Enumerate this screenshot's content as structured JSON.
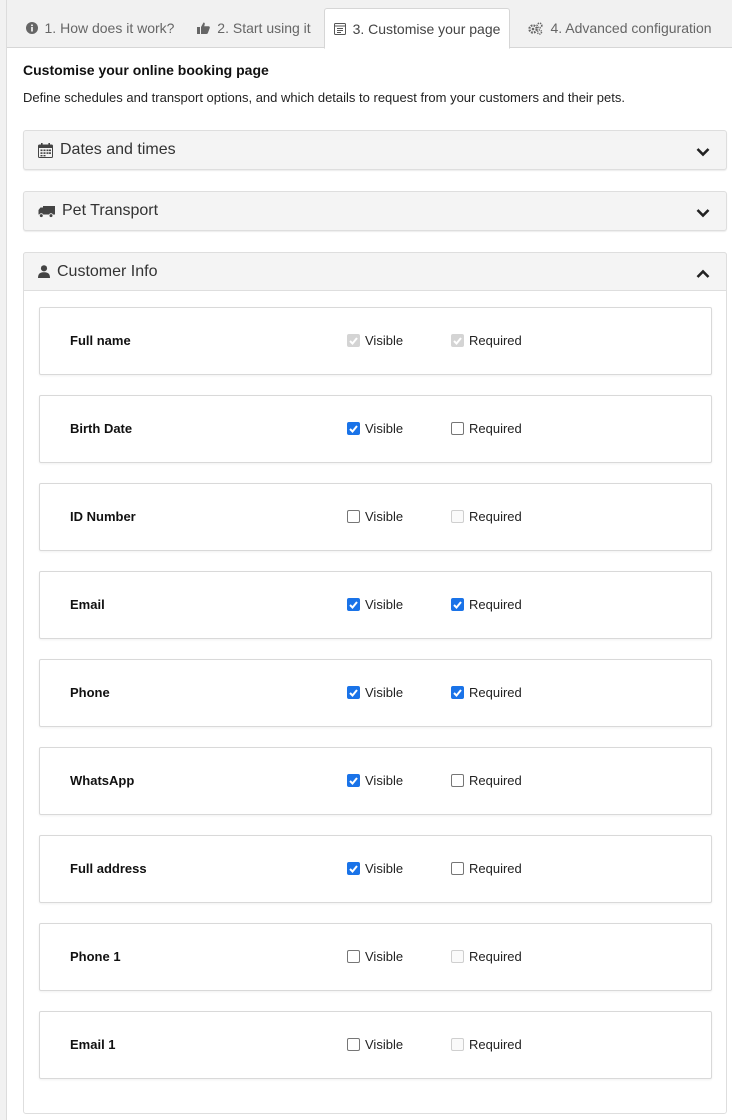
{
  "tabs": [
    {
      "label": "1. How does it work?",
      "icon": "info-circle-icon",
      "active": false
    },
    {
      "label": "2. Start using it",
      "icon": "thumbs-up-icon",
      "active": false
    },
    {
      "label": "3. Customise your page",
      "icon": "page-icon",
      "active": true
    },
    {
      "label": "4. Advanced configuration",
      "icon": "gears-icon",
      "active": false
    }
  ],
  "main": {
    "title": "Customise your online booking page",
    "description": "Define schedules and transport options, and which details to request from your customers and their pets."
  },
  "sections": [
    {
      "label": "Dates and times",
      "icon": "calendar-icon",
      "expanded": false
    },
    {
      "label": "Pet Transport",
      "icon": "truck-icon",
      "expanded": false
    },
    {
      "label": "Customer Info",
      "icon": "user-icon",
      "expanded": true
    }
  ],
  "option_labels": {
    "visible": "Visible",
    "required": "Required"
  },
  "customer_fields": [
    {
      "name": "Full name",
      "visible": true,
      "visible_disabled": true,
      "required": true,
      "required_disabled": true
    },
    {
      "name": "Birth Date",
      "visible": true,
      "visible_disabled": false,
      "required": false,
      "required_disabled": false
    },
    {
      "name": "ID Number",
      "visible": false,
      "visible_disabled": false,
      "required": false,
      "required_disabled": true
    },
    {
      "name": "Email",
      "visible": true,
      "visible_disabled": false,
      "required": true,
      "required_disabled": false
    },
    {
      "name": "Phone",
      "visible": true,
      "visible_disabled": false,
      "required": true,
      "required_disabled": false
    },
    {
      "name": "WhatsApp",
      "visible": true,
      "visible_disabled": false,
      "required": false,
      "required_disabled": false
    },
    {
      "name": "Full address",
      "visible": true,
      "visible_disabled": false,
      "required": false,
      "required_disabled": false
    },
    {
      "name": "Phone 1",
      "visible": false,
      "visible_disabled": false,
      "required": false,
      "required_disabled": true
    },
    {
      "name": "Email 1",
      "visible": false,
      "visible_disabled": false,
      "required": false,
      "required_disabled": true
    }
  ],
  "colors": {
    "accent": "#1a73e8",
    "panel_bg": "#f4f4f4",
    "tabbar_bg": "#f1f1f1"
  }
}
